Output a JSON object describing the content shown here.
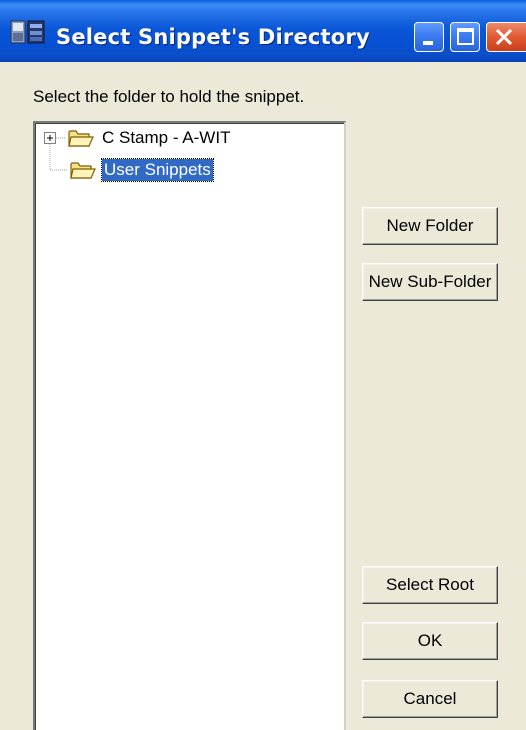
{
  "window": {
    "title": "Select Snippet's Directory"
  },
  "instruction": "Select the folder to hold the snippet.",
  "tree": {
    "nodes": [
      {
        "label": "C Stamp  -  A-WIT",
        "icon": "folder-icon",
        "expander": "plus-expander",
        "selected": false
      },
      {
        "label": "User Snippets",
        "icon": "folder-icon",
        "selected": true
      }
    ]
  },
  "buttons": {
    "new_folder": "New Folder",
    "new_sub_folder": "New Sub-Folder",
    "select_root": "Select Root",
    "ok": "OK",
    "cancel": "Cancel"
  },
  "colors": {
    "title_bar": "#0a58d8",
    "selection": "#316ac5",
    "face": "#ece9d8",
    "close_button": "#e25a34"
  }
}
